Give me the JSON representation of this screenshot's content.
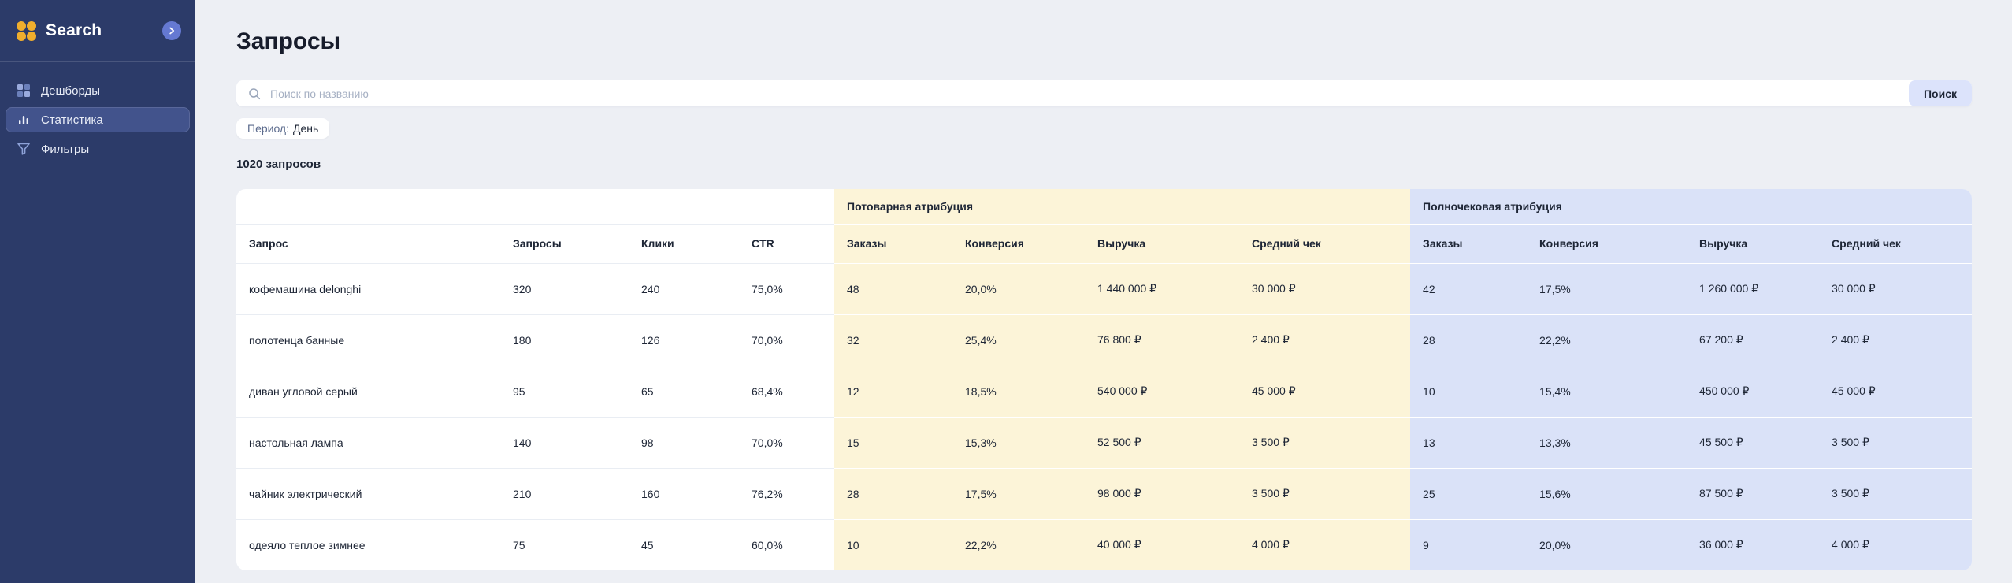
{
  "colors": {
    "sidebar_bg": "#2c3b69",
    "sidebar_active_bg": "#42538c",
    "logo_amber": "#f0ae2d",
    "accent_periwinkle": "#6579d2",
    "page_bg": "#edeff4",
    "group_yellow": "#fcf4d8",
    "group_blue": "#dae2f8",
    "search_button_bg": "#dce3fb",
    "text_dark": "#1e2636"
  },
  "sidebar": {
    "logo_text": "Search",
    "items": [
      {
        "label": "Дешборды",
        "icon": "dashboard-icon",
        "active": false
      },
      {
        "label": "Статистика",
        "icon": "stats-icon",
        "active": true
      },
      {
        "label": "Фильтры",
        "icon": "filter-icon",
        "active": false
      }
    ]
  },
  "header": {
    "title": "Запросы"
  },
  "search": {
    "placeholder": "Поиск по названию",
    "button_label": "Поиск"
  },
  "filter_chip": {
    "label": "Период:",
    "value": "День"
  },
  "summary": {
    "results_count": "1020 запросов"
  },
  "table": {
    "group_headers": [
      {
        "label": "",
        "span": 4,
        "tint": "none"
      },
      {
        "label": "Потоварная атрибуция",
        "span": 4,
        "tint": "yellow"
      },
      {
        "label": "Полночековая атрибуция",
        "span": 4,
        "tint": "blue"
      }
    ],
    "columns": [
      {
        "label": "Запрос",
        "tint": "none"
      },
      {
        "label": "Запросы",
        "tint": "none"
      },
      {
        "label": "Клики",
        "tint": "none"
      },
      {
        "label": "CTR",
        "tint": "none"
      },
      {
        "label": "Заказы",
        "tint": "yellow"
      },
      {
        "label": "Конверсия",
        "tint": "yellow"
      },
      {
        "label": "Выручка",
        "tint": "yellow"
      },
      {
        "label": "Средний чек",
        "tint": "yellow"
      },
      {
        "label": "Заказы",
        "tint": "blue"
      },
      {
        "label": "Конверсия",
        "tint": "blue"
      },
      {
        "label": "Выручка",
        "tint": "blue"
      },
      {
        "label": "Средний чек",
        "tint": "blue"
      }
    ],
    "rows": [
      [
        "кофемашина delonghi",
        "320",
        "240",
        "75,0%",
        "48",
        "20,0%",
        "1 440 000 ₽",
        "30 000 ₽",
        "42",
        "17,5%",
        "1 260 000 ₽",
        "30 000 ₽"
      ],
      [
        "полотенца банные",
        "180",
        "126",
        "70,0%",
        "32",
        "25,4%",
        "76 800 ₽",
        "2 400 ₽",
        "28",
        "22,2%",
        "67 200 ₽",
        "2 400 ₽"
      ],
      [
        "диван угловой серый",
        "95",
        "65",
        "68,4%",
        "12",
        "18,5%",
        "540 000 ₽",
        "45 000 ₽",
        "10",
        "15,4%",
        "450 000 ₽",
        "45 000 ₽"
      ],
      [
        "настольная лампа",
        "140",
        "98",
        "70,0%",
        "15",
        "15,3%",
        "52 500 ₽",
        "3 500 ₽",
        "13",
        "13,3%",
        "45 500 ₽",
        "3 500 ₽"
      ],
      [
        "чайник электрический",
        "210",
        "160",
        "76,2%",
        "28",
        "17,5%",
        "98 000 ₽",
        "3 500 ₽",
        "25",
        "15,6%",
        "87 500 ₽",
        "3 500 ₽"
      ],
      [
        "одеяло теплое зимнее",
        "75",
        "45",
        "60,0%",
        "10",
        "22,2%",
        "40 000 ₽",
        "4 000 ₽",
        "9",
        "20,0%",
        "36 000 ₽",
        "4 000 ₽"
      ]
    ]
  }
}
